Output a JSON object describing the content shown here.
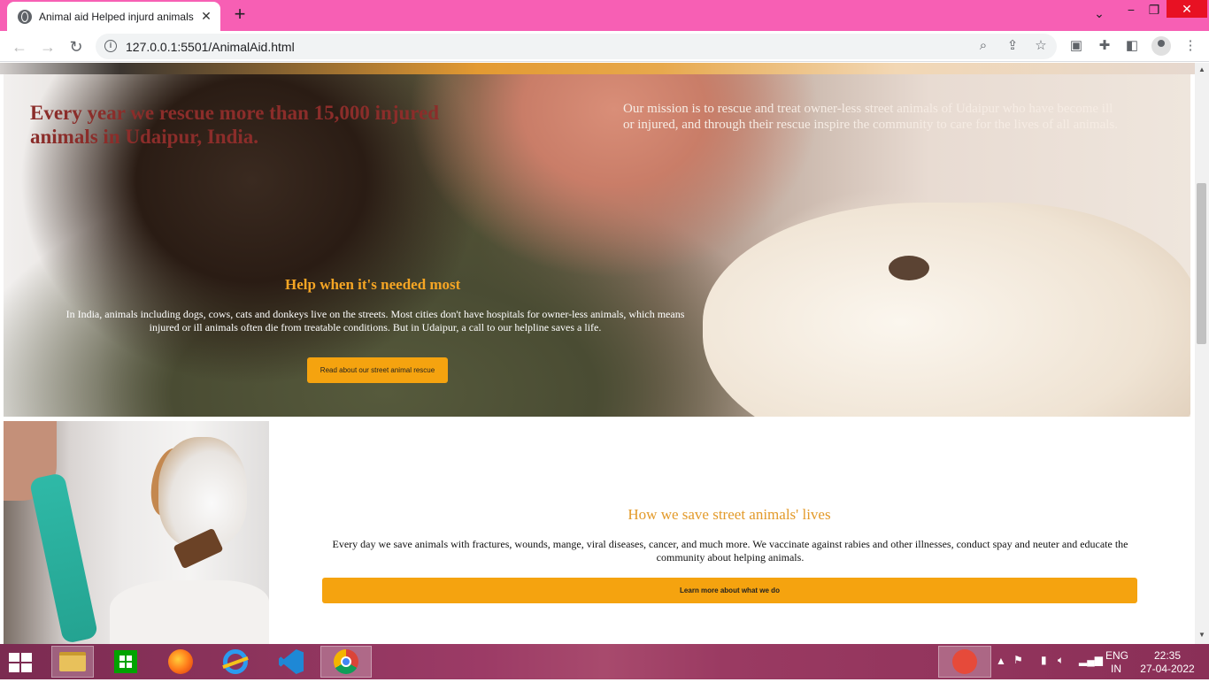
{
  "browser": {
    "tab_title": "Animal aid Helped injurd animals",
    "tab_close": "✕",
    "new_tab": "+",
    "url": "127.0.0.1:5501/AnimalAid.html",
    "window_controls": {
      "minimize": "−",
      "restore": "❐",
      "close": "✕",
      "tab_list": "⌄"
    }
  },
  "hero": {
    "headline": "Every year we rescue more than 15,000 injured animals in Udaipur, India.",
    "mission": "Our mission is to rescue and treat owner-less street animals of Udaipur who have become ill or injured, and through their rescue inspire the community to care for the lives of all animals.",
    "help_title": "Help when it's needed most",
    "help_text": "In India, animals including dogs, cows, cats and donkeys live on the streets. Most cities don't have hospitals for owner-less animals, which means injured or ill animals often die from treatable conditions. But in Udaipur, a call to our helpline saves a life.",
    "help_button": "Read about our street animal rescue"
  },
  "how": {
    "title": "How we save street animals' lives",
    "text": "Every day we save animals with fractures, wounds, mange, viral diseases, cancer, and much more. We vaccinate against rabies and other illnesses, conduct spay and neuter and educate the community about helping animals.",
    "button": "Learn more about what we do"
  },
  "taskbar": {
    "lang_top": "ENG",
    "lang_bottom": "IN",
    "time": "22:35",
    "date": "27-04-2022"
  },
  "colors": {
    "titlebar": "#f75fb4",
    "accent_orange": "#f5a30f",
    "headline_red": "#8b2d2a",
    "taskbar": "#9c3b66"
  },
  "scroll": {
    "position_fraction": 0.27
  }
}
